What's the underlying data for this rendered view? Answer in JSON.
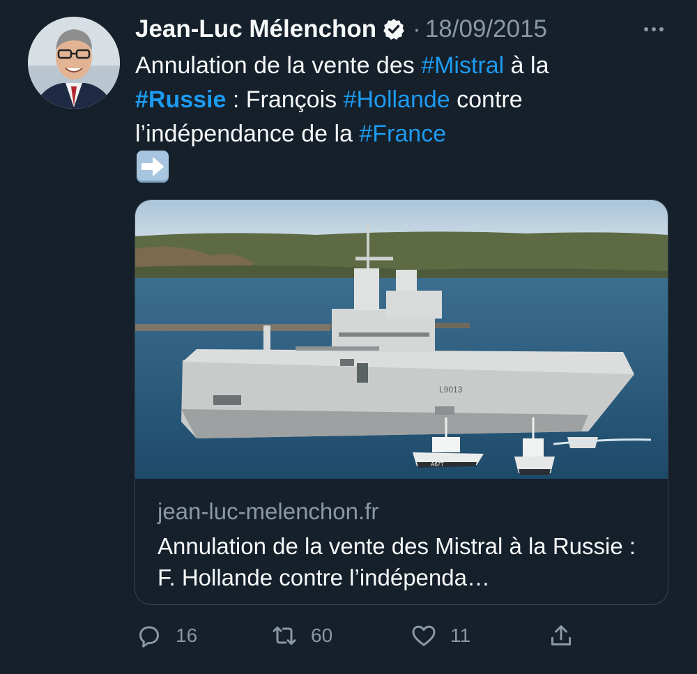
{
  "tweet": {
    "author_name": "Jean-Luc Mélenchon",
    "separator": "·",
    "date": "18/09/2015",
    "text_parts": {
      "p1": "Annulation de la vente des ",
      "tag_mistral": "#Mistral",
      "p2": " à la ",
      "tag_russie": "#Russie",
      "p3": " : François ",
      "tag_hollande": "#Hollande",
      "p4": " contre l’indépendance de la ",
      "tag_france": "#France"
    },
    "emoji": "arrow-right-emoji"
  },
  "card": {
    "domain": "jean-luc-melenchon.fr",
    "title": "Annulation de la vente des Mistral à la Russie : F. Hollande contre l’indépenda…",
    "image_hull_text": "L9013",
    "image_tug_text": "A677"
  },
  "actions": {
    "replies": "16",
    "retweets": "60",
    "likes": "11"
  },
  "colors": {
    "background": "#15202b",
    "hashtag": "#1d9bf0",
    "muted": "#8b98a5",
    "text": "#f7f9f9"
  },
  "icons": [
    "verified-badge-icon",
    "more-icon",
    "reply-icon",
    "retweet-icon",
    "like-icon",
    "share-icon"
  ]
}
